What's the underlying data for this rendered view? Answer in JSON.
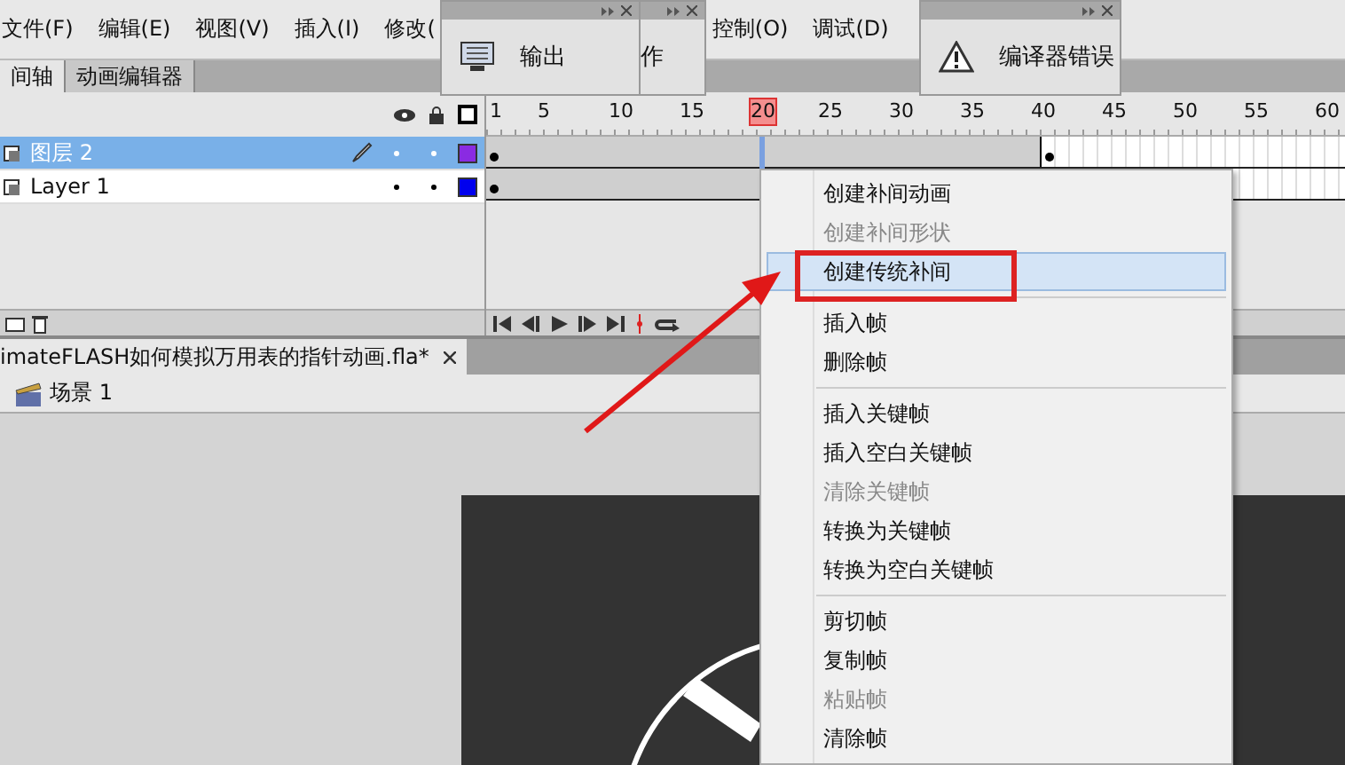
{
  "menu_bar": {
    "items": [
      "文件(F)",
      "编辑(E)",
      "视图(V)",
      "插入(I)",
      "修改(",
      "控制(O)",
      "调试(D)"
    ]
  },
  "panel_tabs": [
    {
      "label": "间轴",
      "selected": true
    },
    {
      "label": "动画编辑器",
      "selected": false
    }
  ],
  "timeline": {
    "frame_numbers": [
      {
        "label": "1",
        "current": false
      },
      {
        "label": "5",
        "current": false
      },
      {
        "label": "10",
        "current": false
      },
      {
        "label": "15",
        "current": false
      },
      {
        "label": "20",
        "current": true
      },
      {
        "label": "25",
        "current": false
      },
      {
        "label": "30",
        "current": false
      },
      {
        "label": "35",
        "current": false
      },
      {
        "label": "40",
        "current": false
      },
      {
        "label": "45",
        "current": false
      },
      {
        "label": "50",
        "current": false
      },
      {
        "label": "55",
        "current": false
      },
      {
        "label": "60",
        "current": false
      }
    ],
    "layers": [
      {
        "name": "图层 2",
        "selected": true,
        "editing": true,
        "color": "#8a2be2"
      },
      {
        "name": "Layer 1",
        "selected": false,
        "editing": false,
        "color": "#0000ee"
      }
    ]
  },
  "document_tab": {
    "title": "imateFLASH如何模拟万用表的指针动画.fla*"
  },
  "breadcrumb": {
    "scene": "场景 1"
  },
  "floating_panels": [
    {
      "title": "输出",
      "kind": "output"
    },
    {
      "title": "作",
      "kind": "actions"
    },
    {
      "title": "编译器错误",
      "kind": "errors"
    }
  ],
  "context_menu": {
    "groups": [
      [
        {
          "label": "创建补间动画",
          "disabled": false,
          "selected": false
        },
        {
          "label": "创建补间形状",
          "disabled": true,
          "selected": false
        },
        {
          "label": "创建传统补间",
          "disabled": false,
          "selected": true
        }
      ],
      [
        {
          "label": "插入帧",
          "disabled": false,
          "selected": false
        },
        {
          "label": "删除帧",
          "disabled": false,
          "selected": false
        }
      ],
      [
        {
          "label": "插入关键帧",
          "disabled": false,
          "selected": false
        },
        {
          "label": "插入空白关键帧",
          "disabled": false,
          "selected": false
        },
        {
          "label": "清除关键帧",
          "disabled": true,
          "selected": false
        },
        {
          "label": "转换为关键帧",
          "disabled": false,
          "selected": false
        },
        {
          "label": "转换为空白关键帧",
          "disabled": false,
          "selected": false
        }
      ],
      [
        {
          "label": "剪切帧",
          "disabled": false,
          "selected": false
        },
        {
          "label": "复制帧",
          "disabled": false,
          "selected": false
        },
        {
          "label": "粘贴帧",
          "disabled": true,
          "selected": false
        },
        {
          "label": "清除帧",
          "disabled": false,
          "selected": false
        }
      ]
    ]
  }
}
